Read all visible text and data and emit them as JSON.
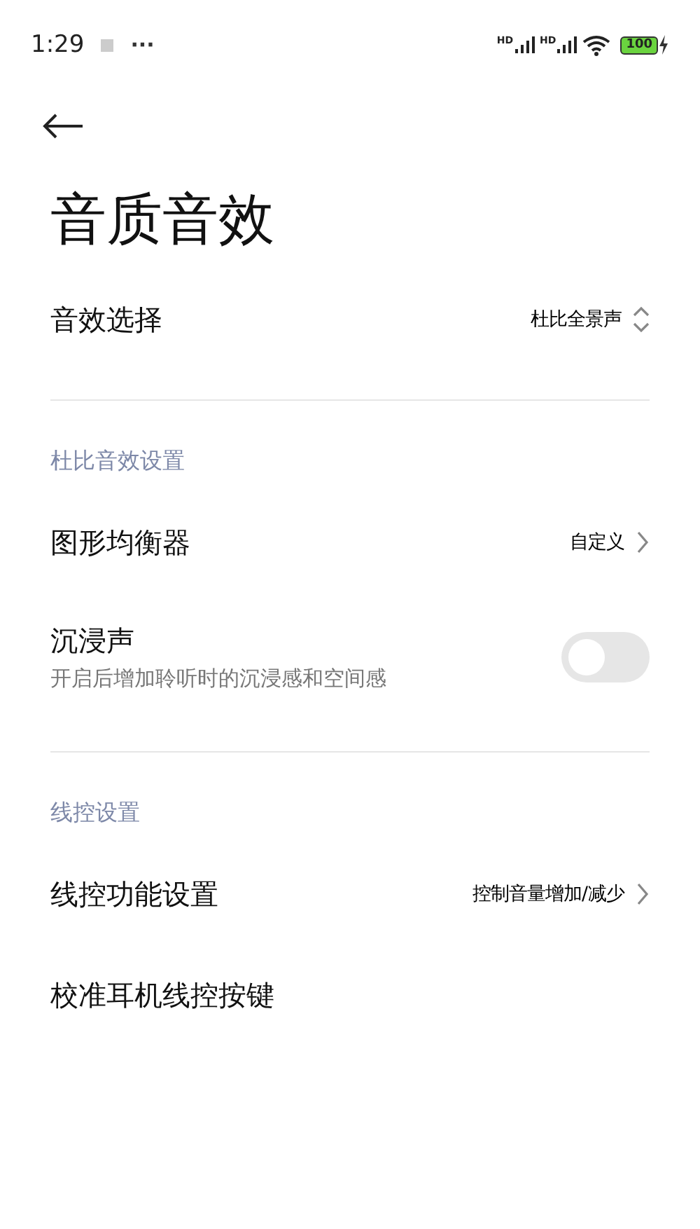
{
  "status_bar": {
    "time": "1:29",
    "more": "···",
    "signals": [
      {
        "label": "HD"
      },
      {
        "label": "HD"
      }
    ],
    "battery": "100"
  },
  "title": "音质音效",
  "groups": [
    {
      "rows": [
        {
          "kind": "select",
          "label": "音效选择",
          "value": "杜比全景声"
        }
      ]
    },
    {
      "header": "杜比音效设置",
      "rows": [
        {
          "kind": "link",
          "label": "图形均衡器",
          "value": "自定义"
        },
        {
          "kind": "toggle",
          "label": "沉浸声",
          "subtitle": "开启后增加聆听时的沉浸感和空间感",
          "on": false
        }
      ]
    },
    {
      "header": "线控设置",
      "rows": [
        {
          "kind": "link",
          "label": "线控功能设置",
          "value": "控制音量增加/减少"
        },
        {
          "kind": "plain",
          "label": "校准耳机线控按键"
        }
      ]
    }
  ]
}
